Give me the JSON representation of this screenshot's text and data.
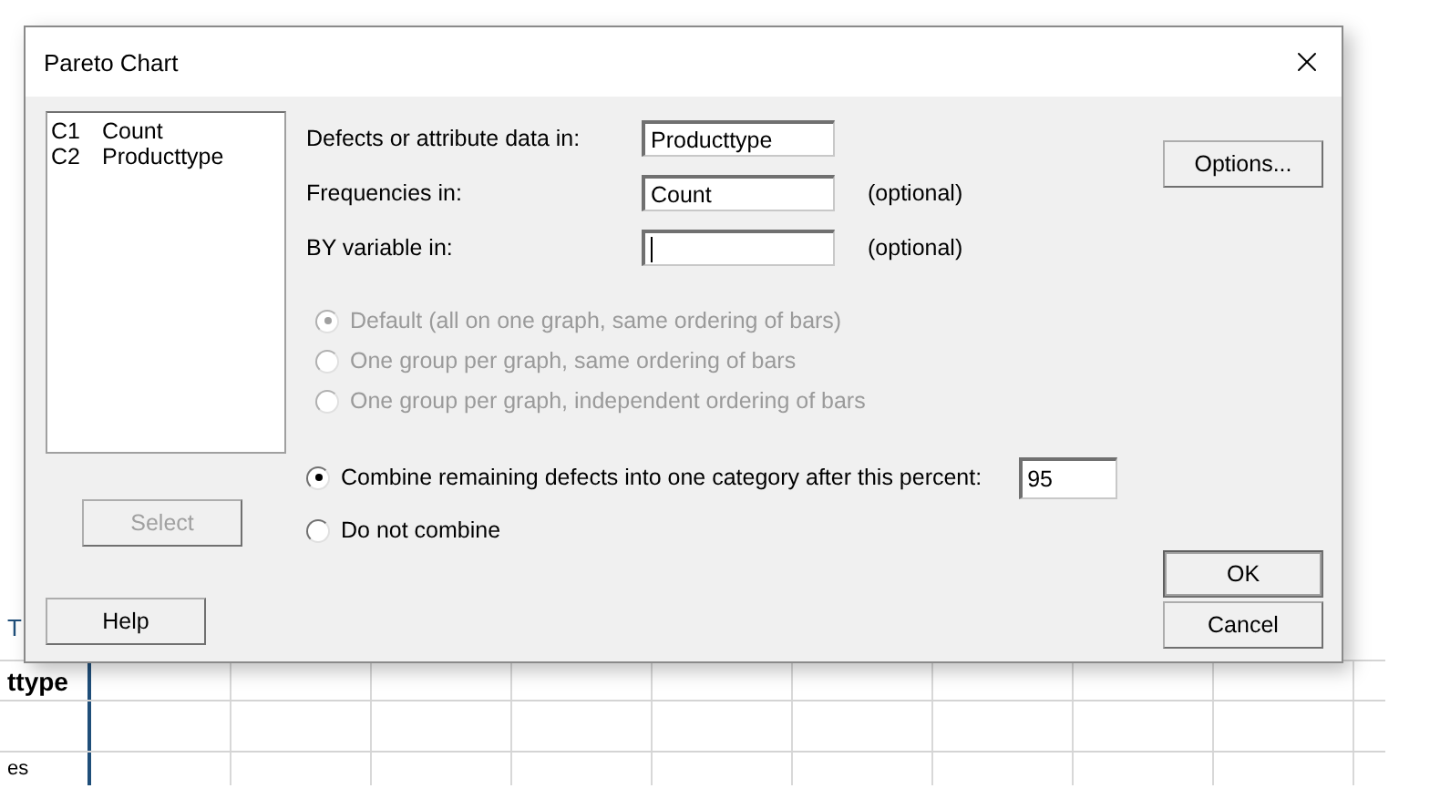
{
  "dialog": {
    "title": "Pareto Chart",
    "columns": [
      {
        "id": "C1",
        "name": "Count"
      },
      {
        "id": "C2",
        "name": "Producttype"
      }
    ],
    "fields": [
      {
        "label": "Defects or attribute data in:",
        "value": "Producttype",
        "focused": false
      },
      {
        "label": "Frequencies in:",
        "value": "Count",
        "note": "(optional)",
        "focused": false
      },
      {
        "label": "BY variable in:",
        "note": "(optional)",
        "focused": true
      }
    ],
    "group_options": [
      {
        "label": "Default (all on one graph, same ordering of bars)",
        "selected": true,
        "disabled": true
      },
      {
        "label": "One group per graph, same ordering of bars",
        "selected": false,
        "disabled": true
      },
      {
        "label": "One group per graph, independent ordering of bars",
        "selected": false,
        "disabled": true
      }
    ],
    "combine_options": [
      {
        "label": "Combine remaining defects into one category after this percent:",
        "selected": true,
        "value": "95"
      },
      {
        "label": "Do not combine",
        "selected": false
      }
    ],
    "select_button": {
      "label": "Select",
      "disabled": true
    },
    "help_button": {
      "label": "Help"
    },
    "options_button": {
      "label": "Options..."
    },
    "ok_button": {
      "label": "OK",
      "default": true
    },
    "cancel_button": {
      "label": "Cancel"
    }
  },
  "sheet": {
    "column_label": "T",
    "header_cell": "ttype",
    "row_cell": "es"
  }
}
